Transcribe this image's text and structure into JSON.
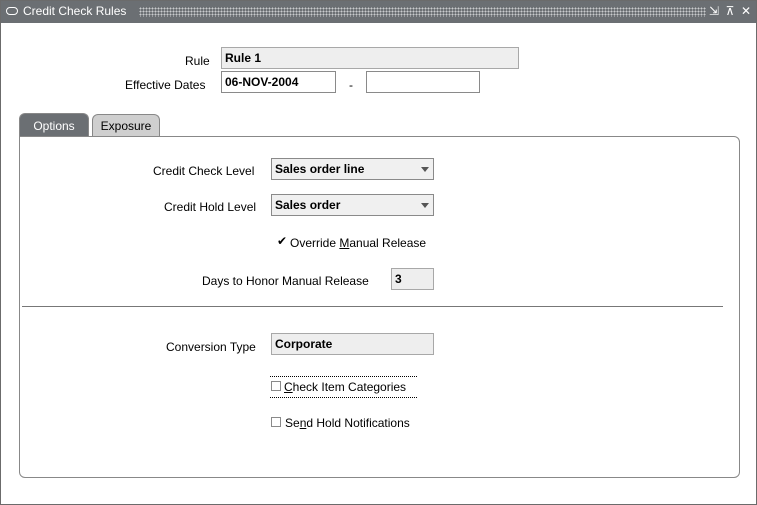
{
  "window": {
    "title": "Credit Check Rules",
    "controls": {
      "minimize": "⇲",
      "maximize": "⊼",
      "close": "✕"
    }
  },
  "header": {
    "rule_label": "Rule",
    "rule_value": "Rule 1",
    "effective_dates_label": "Effective Dates",
    "date_from": "06-NOV-2004",
    "date_separator": "-",
    "date_to": ""
  },
  "tabs": [
    {
      "label": "Options",
      "active": true
    },
    {
      "label": "Exposure",
      "active": false
    }
  ],
  "options": {
    "credit_check_level_label": "Credit Check Level",
    "credit_check_level_value": "Sales order line",
    "credit_hold_level_label": "Credit Hold Level",
    "credit_hold_level_value": "Sales order",
    "override_manual_release": {
      "label_pre": "Override ",
      "label_underlined": "M",
      "label_post": "anual Release",
      "checked": true
    },
    "days_to_honor_label": "Days to Honor Manual Release",
    "days_to_honor_value": "3",
    "conversion_type_label": "Conversion Type",
    "conversion_type_value": "Corporate",
    "check_item_categories": {
      "label_pre": "",
      "label_underlined": "C",
      "label_post": "heck Item Categories",
      "checked": false
    },
    "send_hold_notifications": {
      "label_pre": "Se",
      "label_underlined": "n",
      "label_post": "d Hold Notifications",
      "checked": false
    }
  },
  "colors": {
    "titlebar": "#6b6f73",
    "active_tab": "#6b6f73",
    "inactive_tab": "#cfcfcf"
  }
}
